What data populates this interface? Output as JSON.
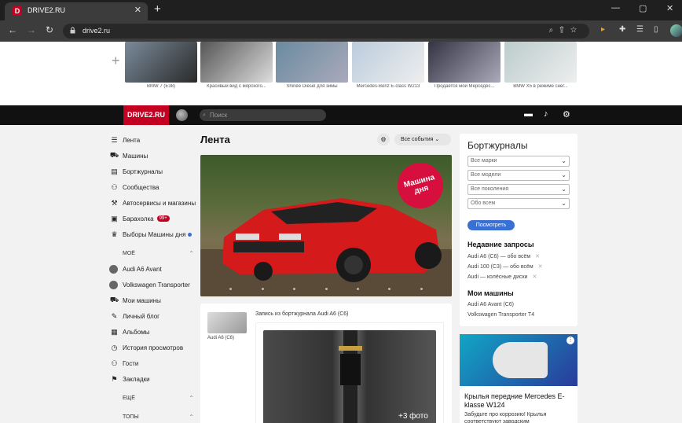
{
  "browser": {
    "tab_title": "DRIVE2.RU",
    "tab_favicon_letter": "D",
    "url": "drive2.ru",
    "newtab_glyph": "+",
    "close_glyph": "✕"
  },
  "stories": [
    {
      "caption": "BMW 7 (E38)",
      "colors": [
        "#7a8a9a",
        "#2a2a2a"
      ]
    },
    {
      "caption": "Красивый вид с морского...",
      "colors": [
        "#555",
        "#ddd"
      ]
    },
    {
      "caption": "Shinee Diesel для зимы",
      "colors": [
        "#6a8aa0",
        "#aab"
      ]
    },
    {
      "caption": "Mercedes-Benz E-class W213",
      "colors": [
        "#bcd",
        "#eee"
      ]
    },
    {
      "caption": "Продается мой Мерседес...",
      "colors": [
        "#334",
        "#aab"
      ]
    },
    {
      "caption": "BMW X5 в режиме снег...",
      "colors": [
        "#bcc",
        "#eee"
      ]
    }
  ],
  "topbar": {
    "logo": "DRIVE2.RU",
    "search_placeholder": "Поиск"
  },
  "nav": {
    "main": [
      {
        "label": "Лента",
        "icon": "feed-icon"
      },
      {
        "label": "Машины",
        "icon": "car-icon"
      },
      {
        "label": "Бортжурналы",
        "icon": "logbook-icon"
      },
      {
        "label": "Сообщества",
        "icon": "community-icon"
      },
      {
        "label": "Автосервисы и магазины",
        "icon": "service-icon"
      },
      {
        "label": "Барахолка",
        "icon": "market-icon",
        "badge": "99+"
      },
      {
        "label": "Выборы Машины дня",
        "icon": "trophy-icon",
        "dot": true
      }
    ],
    "section_mine": "МОЁ",
    "mine": [
      {
        "label": "Audi A6 Avant",
        "icon": "car-avatar"
      },
      {
        "label": "Volkswagen Transporter",
        "icon": "car-avatar"
      },
      {
        "label": "Мои машины",
        "icon": "cars-icon"
      },
      {
        "label": "Личный блог",
        "icon": "blog-icon"
      },
      {
        "label": "Альбомы",
        "icon": "album-icon"
      },
      {
        "label": "История просмотров",
        "icon": "history-icon"
      },
      {
        "label": "Гости",
        "icon": "guests-icon"
      },
      {
        "label": "Закладки",
        "icon": "bookmark-icon"
      }
    ],
    "section_more": "ЕЩЁ",
    "section_top": "ТОПЫ"
  },
  "feed": {
    "title": "Лента",
    "events_label": "Все события",
    "stamp": "Машина дня",
    "post": {
      "heading": "Запись из бортжурнала Audi A6 (C6)",
      "caption": "Audi A6 (C6)",
      "more_photos": "+3 фото"
    }
  },
  "logbook": {
    "title": "Бортжурналы",
    "selects": [
      "Все марки",
      "Все модели",
      "Все поколения",
      "Обо всем"
    ],
    "show_button": "Посмотреть",
    "recent_title": "Недавние запросы",
    "recent": [
      "Audi A6 (C6) — обо всём",
      "Audi 100 (C3) — обо всём",
      "Audi — колёсные диски"
    ],
    "mycars_title": "Мои машины",
    "mycars": [
      "Audi A6 Avant (C6)",
      "Volkswagen Transporter T4"
    ]
  },
  "ad": {
    "title": "Крылья передние Mercedes E-klasse W124",
    "text": "Забудьте про коррозию! Крылья соответствуют заводским"
  },
  "colors": {
    "brand_red": "#c40022",
    "accent_blue": "#3a70d4",
    "stamp_red": "#d60f3e"
  }
}
